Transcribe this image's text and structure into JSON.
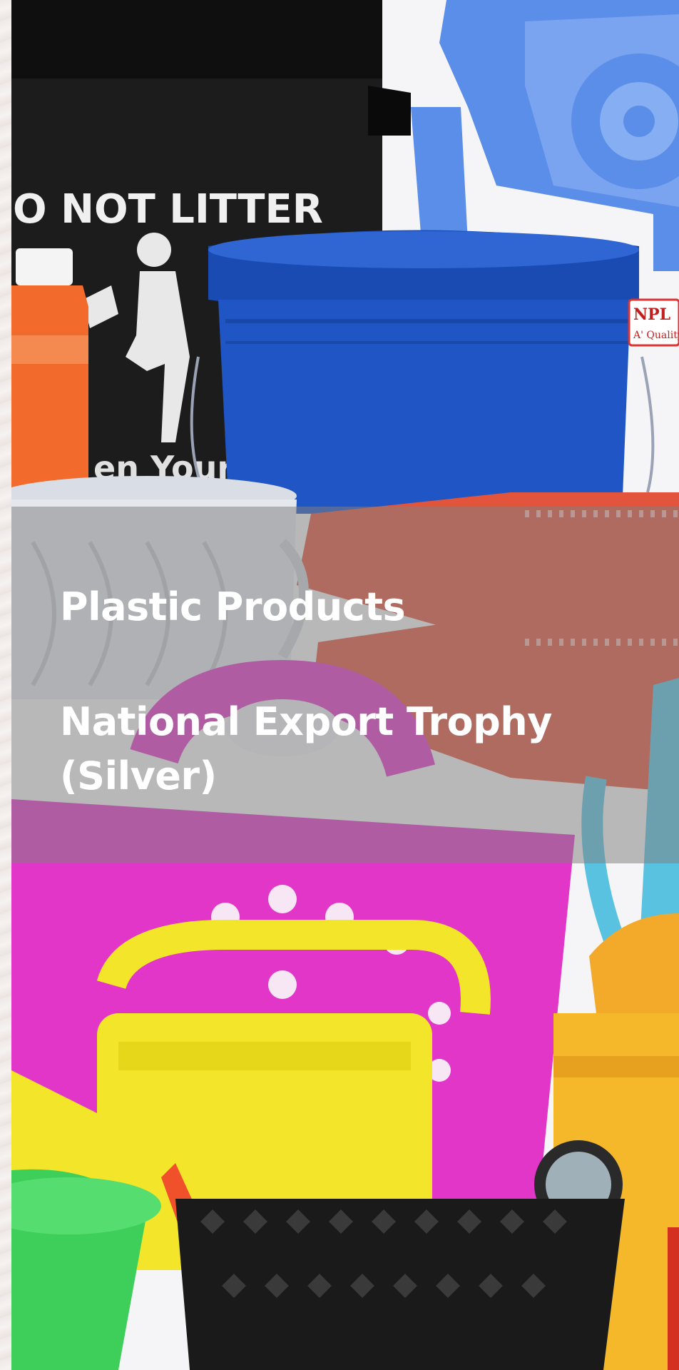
{
  "card": {
    "title": "Plastic Products",
    "award": "National Export Trophy (Silver)"
  },
  "photo": {
    "bin_text": "O NOT LITTER",
    "bin_text_bottom": "en Your",
    "bucket_brand": "NPL",
    "bucket_quality": "A' Quality"
  },
  "colors": {
    "overlay": "#808080",
    "bin": "#1c1c1c",
    "blue_bucket": "#1f55c4",
    "chair": "#5b8ee8",
    "tray": "#e2553c",
    "pink_basket": "#e236c8",
    "watering_can": "#f2e52a",
    "yellow_container": "#f5b82a",
    "green_bowl": "#3ecf5a",
    "black_basket": "#1a1a1a"
  }
}
